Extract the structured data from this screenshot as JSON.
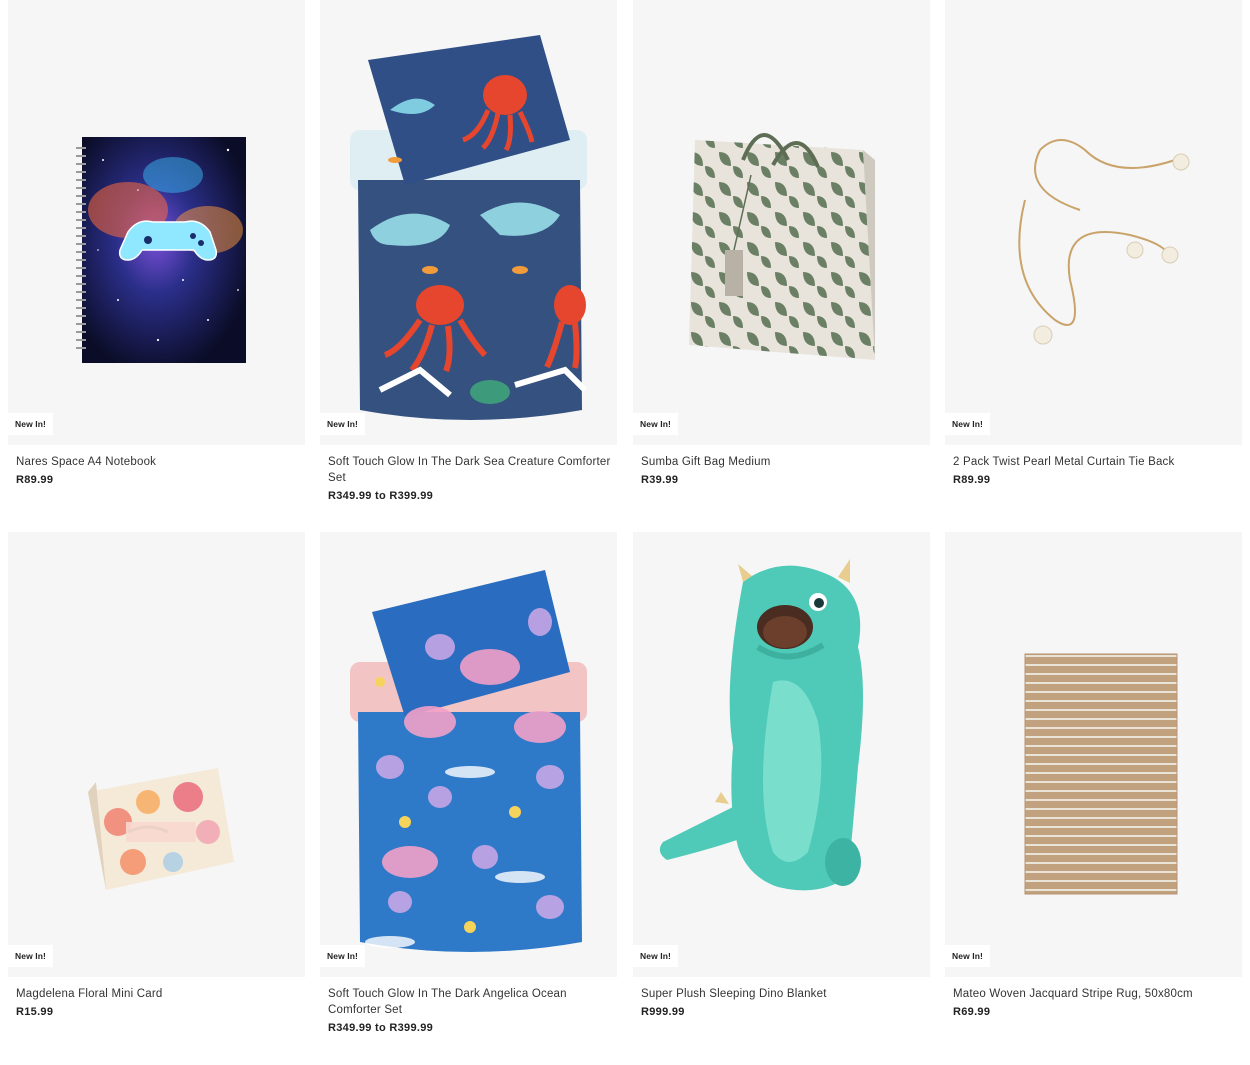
{
  "products": [
    {
      "badge": "New In!",
      "name": "Nares Space A4 Notebook",
      "price": "R89.99",
      "image": "space-notebook-image"
    },
    {
      "badge": "New In!",
      "name": "Soft Touch Glow In The Dark Sea Creature Comforter Set",
      "price": "R349.99 to R399.99",
      "image": "sea-creature-comforter-image"
    },
    {
      "badge": "New In!",
      "name": "Sumba Gift Bag Medium",
      "price": "R39.99",
      "image": "gift-bag-image"
    },
    {
      "badge": "New In!",
      "name": "2 Pack Twist Pearl Metal Curtain Tie Back",
      "price": "R89.99",
      "image": "curtain-tie-back-image"
    },
    {
      "badge": "New In!",
      "name": "Magdelena Floral Mini Card",
      "price": "R15.99",
      "image": "floral-card-image"
    },
    {
      "badge": "New In!",
      "name": "Soft Touch Glow In The Dark Angelica Ocean Comforter Set",
      "price": "R349.99 to R399.99",
      "image": "ocean-comforter-image"
    },
    {
      "badge": "New In!",
      "name": "Super Plush Sleeping Dino Blanket",
      "price": "R999.99",
      "image": "dino-blanket-image"
    },
    {
      "badge": "New In!",
      "name": "Mateo Woven Jacquard Stripe Rug, 50x80cm",
      "price": "R69.99",
      "image": "stripe-rug-image"
    }
  ]
}
